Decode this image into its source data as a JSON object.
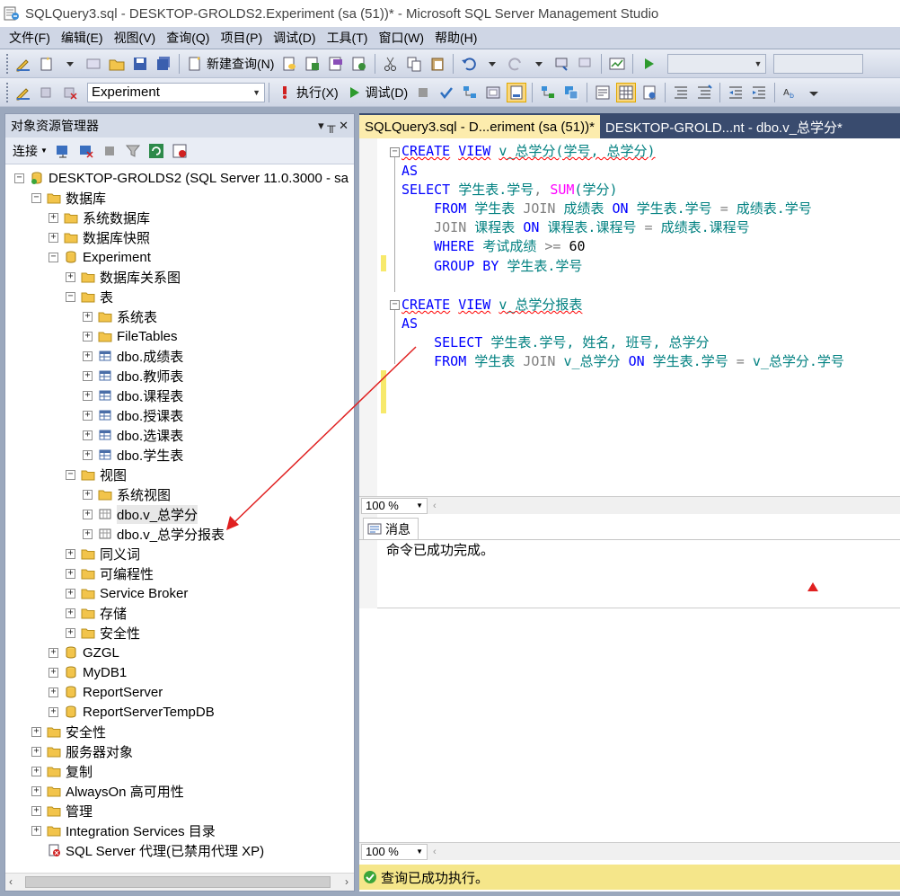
{
  "window": {
    "title": "SQLQuery3.sql - DESKTOP-GROLDS2.Experiment (sa (51))* - Microsoft SQL Server Management Studio"
  },
  "menu": [
    "文件(F)",
    "编辑(E)",
    "视图(V)",
    "查询(Q)",
    "项目(P)",
    "调试(D)",
    "工具(T)",
    "窗口(W)",
    "帮助(H)"
  ],
  "toolbar1": {
    "new_query_label": "新建查询(N)"
  },
  "toolbar2": {
    "database_selected": "Experiment",
    "execute_label": "执行(X)",
    "debug_label": "调试(D)"
  },
  "explorer": {
    "title": "对象资源管理器",
    "pin_glyph": "▾ ╥ ✕",
    "connect_label": "连接"
  },
  "tree": {
    "n0": "DESKTOP-GROLDS2 (SQL Server 11.0.3000 - sa",
    "n1": "数据库",
    "n2": "系统数据库",
    "n3": "数据库快照",
    "n4": "Experiment",
    "n5": "数据库关系图",
    "n6": "表",
    "n7": "系统表",
    "n8": "FileTables",
    "n9": "dbo.成绩表",
    "n10": "dbo.教师表",
    "n11": "dbo.课程表",
    "n12": "dbo.授课表",
    "n13": "dbo.选课表",
    "n14": "dbo.学生表",
    "n15": "视图",
    "n16": "系统视图",
    "n17": "dbo.v_总学分",
    "n18": "dbo.v_总学分报表",
    "n19": "同义词",
    "n20": "可编程性",
    "n21": "Service Broker",
    "n22": "存储",
    "n23": "安全性",
    "n24": "GZGL",
    "n25": "MyDB1",
    "n26": "ReportServer",
    "n27": "ReportServerTempDB",
    "n28": "安全性",
    "n29": "服务器对象",
    "n30": "复制",
    "n31": "AlwaysOn 高可用性",
    "n32": "管理",
    "n33": "Integration Services 目录",
    "n34": "SQL Server 代理(已禁用代理 XP)"
  },
  "tabs": {
    "active": "SQLQuery3.sql - D...eriment (sa (51))*",
    "inactive": "DESKTOP-GROLD...nt - dbo.v_总学分*"
  },
  "code": {
    "l1": {
      "kw1": "CREATE",
      "kw2": "VIEW",
      "name": "v_总学分(学号, 总学分)"
    },
    "l2": "AS",
    "l3": {
      "kw": "SELECT",
      "a": "学生表.学号",
      "comma": ",",
      "fn": "SUM",
      "b": "(学分)"
    },
    "l4": {
      "kw1": "FROM",
      "a": "学生表",
      "kw2": "JOIN",
      "b": "成绩表",
      "kw3": "ON",
      "c": "学生表.学号",
      "eq": "=",
      "d": "成绩表.学号"
    },
    "l5": {
      "kw1": "JOIN",
      "a": "课程表",
      "kw2": "ON",
      "b": "课程表.课程号",
      "eq": "=",
      "c": "成绩表.课程号"
    },
    "l6": {
      "kw": "WHERE",
      "a": "考试成绩",
      "op": ">=",
      "num": "60"
    },
    "l7": {
      "kw": "GROUP BY",
      "a": "学生表.学号"
    },
    "l8": {
      "kw1": "CREATE",
      "kw2": "VIEW",
      "name": "v_总学分报表"
    },
    "l9": "AS",
    "l10": {
      "kw": "SELECT",
      "a": "学生表.学号, 姓名, 班号, 总学分"
    },
    "l11": {
      "kw1": "FROM",
      "a": "学生表",
      "kw2": "JOIN",
      "b": "v_总学分",
      "kw3": "ON",
      "c": "学生表.学号",
      "eq": "=",
      "d": "v_总学分.学号"
    }
  },
  "zoom": {
    "value": "100 %"
  },
  "results": {
    "tab_label": "消息",
    "message": "命令已成功完成。"
  },
  "status": {
    "text": "查询已成功执行。"
  }
}
